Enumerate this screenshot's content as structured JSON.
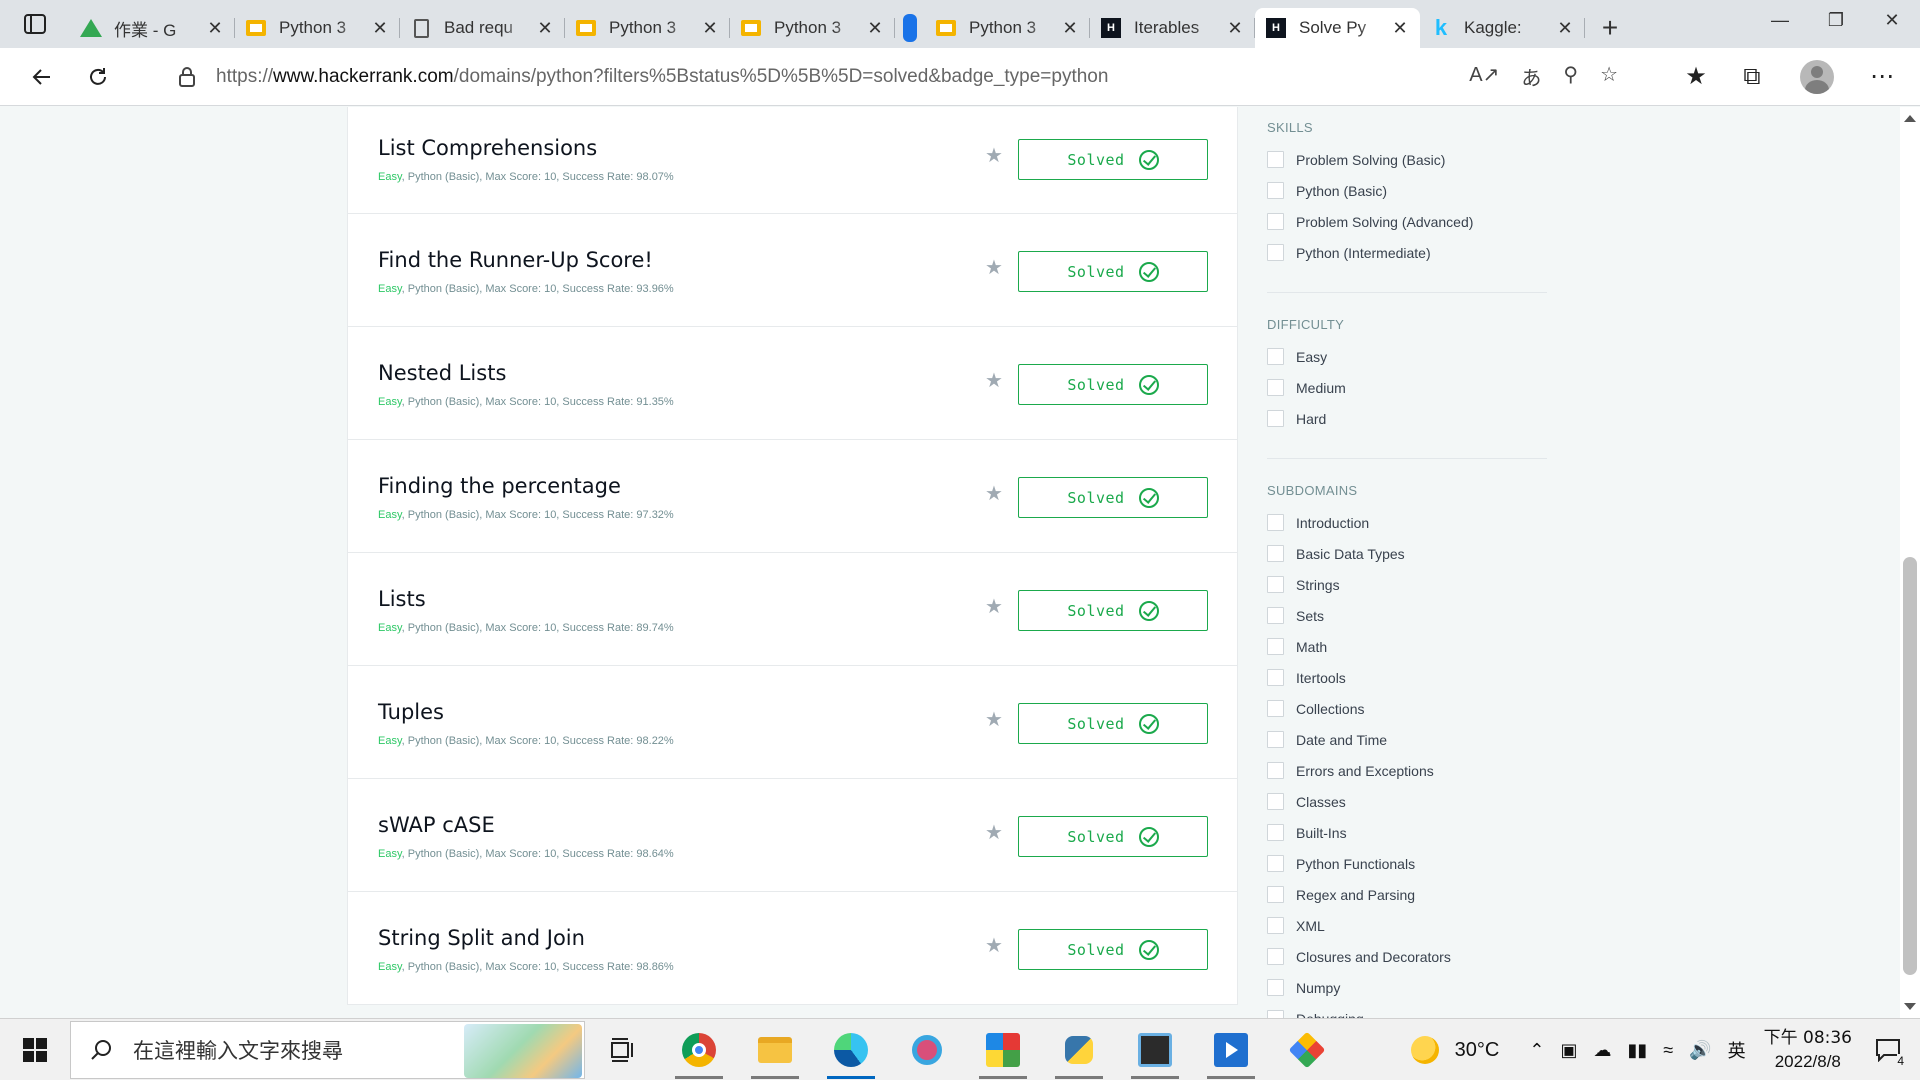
{
  "browser": {
    "tabs": [
      {
        "title": "作業 - G",
        "icon": "google-drive-icon",
        "active": false
      },
      {
        "title": "Python 3",
        "icon": "google-slides-icon",
        "active": false
      },
      {
        "title": "Bad requ",
        "icon": "document-icon",
        "active": false
      },
      {
        "title": "Python 3",
        "icon": "google-slides-icon",
        "active": false
      },
      {
        "title": "Python 3",
        "icon": "google-slides-icon",
        "active": false
      },
      {
        "title": "Python 3",
        "icon": "google-slides-icon",
        "active": false
      },
      {
        "title": "Iterables",
        "icon": "hackerrank-icon",
        "active": false
      },
      {
        "title": "Solve Py",
        "icon": "hackerrank-icon",
        "active": true
      },
      {
        "title": "Kaggle:",
        "icon": "kaggle-icon",
        "active": false
      }
    ],
    "close_glyph": "✕",
    "new_tab_glyph": "+",
    "url": {
      "prefix": "https://",
      "host": "www.hackerrank.com",
      "path": "/domains/python?filters%5Bstatus%5D%5B%5D=solved&badge_type=python"
    }
  },
  "challenges": [
    {
      "title": "List Comprehensions",
      "difficulty": "Easy",
      "meta": ", Python (Basic), Max Score: 10, Success Rate: 98.07%",
      "status": "Solved"
    },
    {
      "title": "Find the Runner-Up Score!",
      "difficulty": "Easy",
      "meta": ", Python (Basic), Max Score: 10, Success Rate: 93.96%",
      "status": "Solved"
    },
    {
      "title": "Nested Lists",
      "difficulty": "Easy",
      "meta": ", Python (Basic), Max Score: 10, Success Rate: 91.35%",
      "status": "Solved"
    },
    {
      "title": "Finding the percentage",
      "difficulty": "Easy",
      "meta": ", Python (Basic), Max Score: 10, Success Rate: 97.32%",
      "status": "Solved"
    },
    {
      "title": "Lists",
      "difficulty": "Easy",
      "meta": ", Python (Basic), Max Score: 10, Success Rate: 89.74%",
      "status": "Solved"
    },
    {
      "title": "Tuples",
      "difficulty": "Easy",
      "meta": ", Python (Basic), Max Score: 10, Success Rate: 98.22%",
      "status": "Solved"
    },
    {
      "title": "sWAP cASE",
      "difficulty": "Easy",
      "meta": ", Python (Basic), Max Score: 10, Success Rate: 98.64%",
      "status": "Solved"
    },
    {
      "title": "String Split and Join",
      "difficulty": "Easy",
      "meta": ", Python (Basic), Max Score: 10, Success Rate: 98.86%",
      "status": "Solved"
    }
  ],
  "filters": {
    "skills": {
      "heading": "SKILLS",
      "items": [
        "Problem Solving (Basic)",
        "Python (Basic)",
        "Problem Solving (Advanced)",
        "Python (Intermediate)"
      ]
    },
    "difficulty": {
      "heading": "DIFFICULTY",
      "items": [
        "Easy",
        "Medium",
        "Hard"
      ]
    },
    "subdomains": {
      "heading": "SUBDOMAINS",
      "items": [
        "Introduction",
        "Basic Data Types",
        "Strings",
        "Sets",
        "Math",
        "Itertools",
        "Collections",
        "Date and Time",
        "Errors and Exceptions",
        "Classes",
        "Built-Ins",
        "Python Functionals",
        "Regex and Parsing",
        "XML",
        "Closures and Decorators",
        "Numpy",
        "Debugging"
      ]
    }
  },
  "taskbar": {
    "search_placeholder": "在這裡輸入文字來搜尋",
    "weather": "30°C",
    "ime": "英",
    "time": "下午 08:36",
    "date": "2022/8/8",
    "notification_count": "4"
  },
  "colors": {
    "accent_green": "#1ba94c",
    "easy_green": "#2ec866"
  }
}
